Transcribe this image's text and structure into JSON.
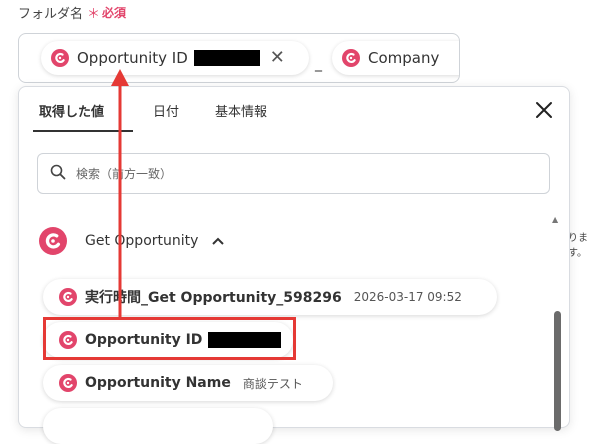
{
  "field": {
    "label": "フォルダ名",
    "required_mark": "＊",
    "required_text": "必須",
    "chips": [
      {
        "label": "Opportunity ID",
        "remove": "✕"
      },
      {
        "label": "Company"
      }
    ],
    "separator": "_"
  },
  "dropdown": {
    "tabs": [
      {
        "label": "取得した値",
        "active": true
      },
      {
        "label": "日付"
      },
      {
        "label": "基本情報"
      }
    ],
    "search_placeholder": "検索（前方一致）",
    "section_label": "Get Opportunity",
    "items": [
      {
        "name": "実行時間_Get Opportunity_598296",
        "value": "2026-03-17 09:52"
      },
      {
        "name": "Opportunity ID",
        "value": ""
      },
      {
        "name": "Opportunity Name",
        "value": "商談テスト"
      },
      {
        "name": "",
        "value": ""
      }
    ]
  },
  "background_text": "ります。",
  "colors": {
    "accent": "#e2456b",
    "highlight": "#e53935",
    "redaction": "#000000"
  },
  "icons": [
    "logo-icon",
    "close-icon",
    "search-icon",
    "chevron-up-icon",
    "scroll-up-icon"
  ]
}
